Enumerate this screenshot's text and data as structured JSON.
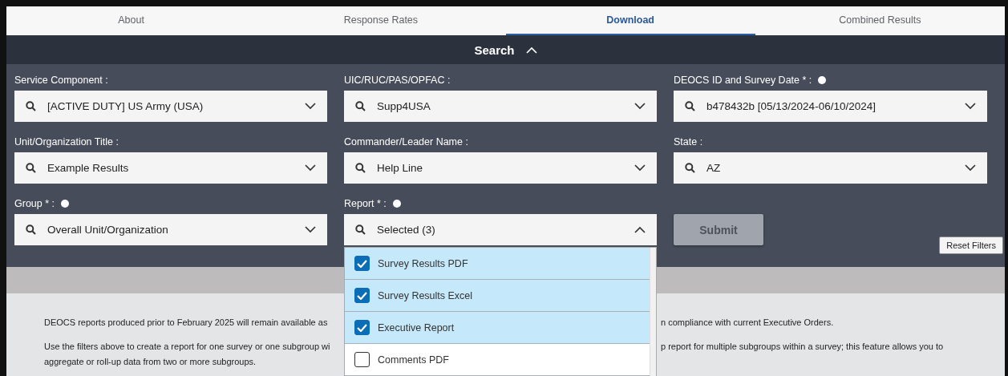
{
  "tabs": [
    {
      "label": "About",
      "selected": false
    },
    {
      "label": "Response Rates",
      "selected": false
    },
    {
      "label": "Download",
      "selected": true
    },
    {
      "label": "Combined Results",
      "selected": false
    }
  ],
  "search_header": {
    "title": "Search",
    "expanded": true
  },
  "filters": [
    {
      "label": "Service Component :",
      "info": false,
      "value": "[ACTIVE DUTY] US Army (USA)",
      "open": false
    },
    {
      "label": "UIC/RUC/PAS/OPFAC :",
      "info": false,
      "value": "Supp4USA",
      "open": false
    },
    {
      "label": "DEOCS ID and Survey Date * :",
      "info": true,
      "value": "b478432b [05/13/2024-06/10/2024]",
      "open": false
    },
    {
      "label": "Unit/Organization Title :",
      "info": false,
      "value": "Example Results",
      "open": false
    },
    {
      "label": "Commander/Leader Name :",
      "info": false,
      "value": "Help Line",
      "open": false
    },
    {
      "label": "State :",
      "info": false,
      "value": "AZ",
      "open": false
    },
    {
      "label": "Group * :",
      "info": true,
      "value": "Overall Unit/Organization",
      "open": false
    },
    {
      "label": "Report * :",
      "info": true,
      "value": "Selected (3)",
      "open": true,
      "options": [
        {
          "label": "Survey Results PDF",
          "checked": true
        },
        {
          "label": "Survey Results Excel",
          "checked": true
        },
        {
          "label": "Executive Report",
          "checked": true
        },
        {
          "label": "Comments PDF",
          "checked": false
        }
      ]
    }
  ],
  "submit": {
    "label": "Submit",
    "disabled": true
  },
  "reset_button": "Reset Filters",
  "notice": [
    {
      "text_left": "DEOCS reports produced prior to February 2025 will remain available as",
      "text_right": "n compliance with current Executive Orders."
    },
    {
      "text_left": "Use the filters above to create a report for one survey or one subgroup wi",
      "text_right": "p report for multiple subgroups within a survey; this feature allows you to"
    },
    {
      "text_left": "aggregate or roll-up data from two or more subgroups."
    }
  ]
}
